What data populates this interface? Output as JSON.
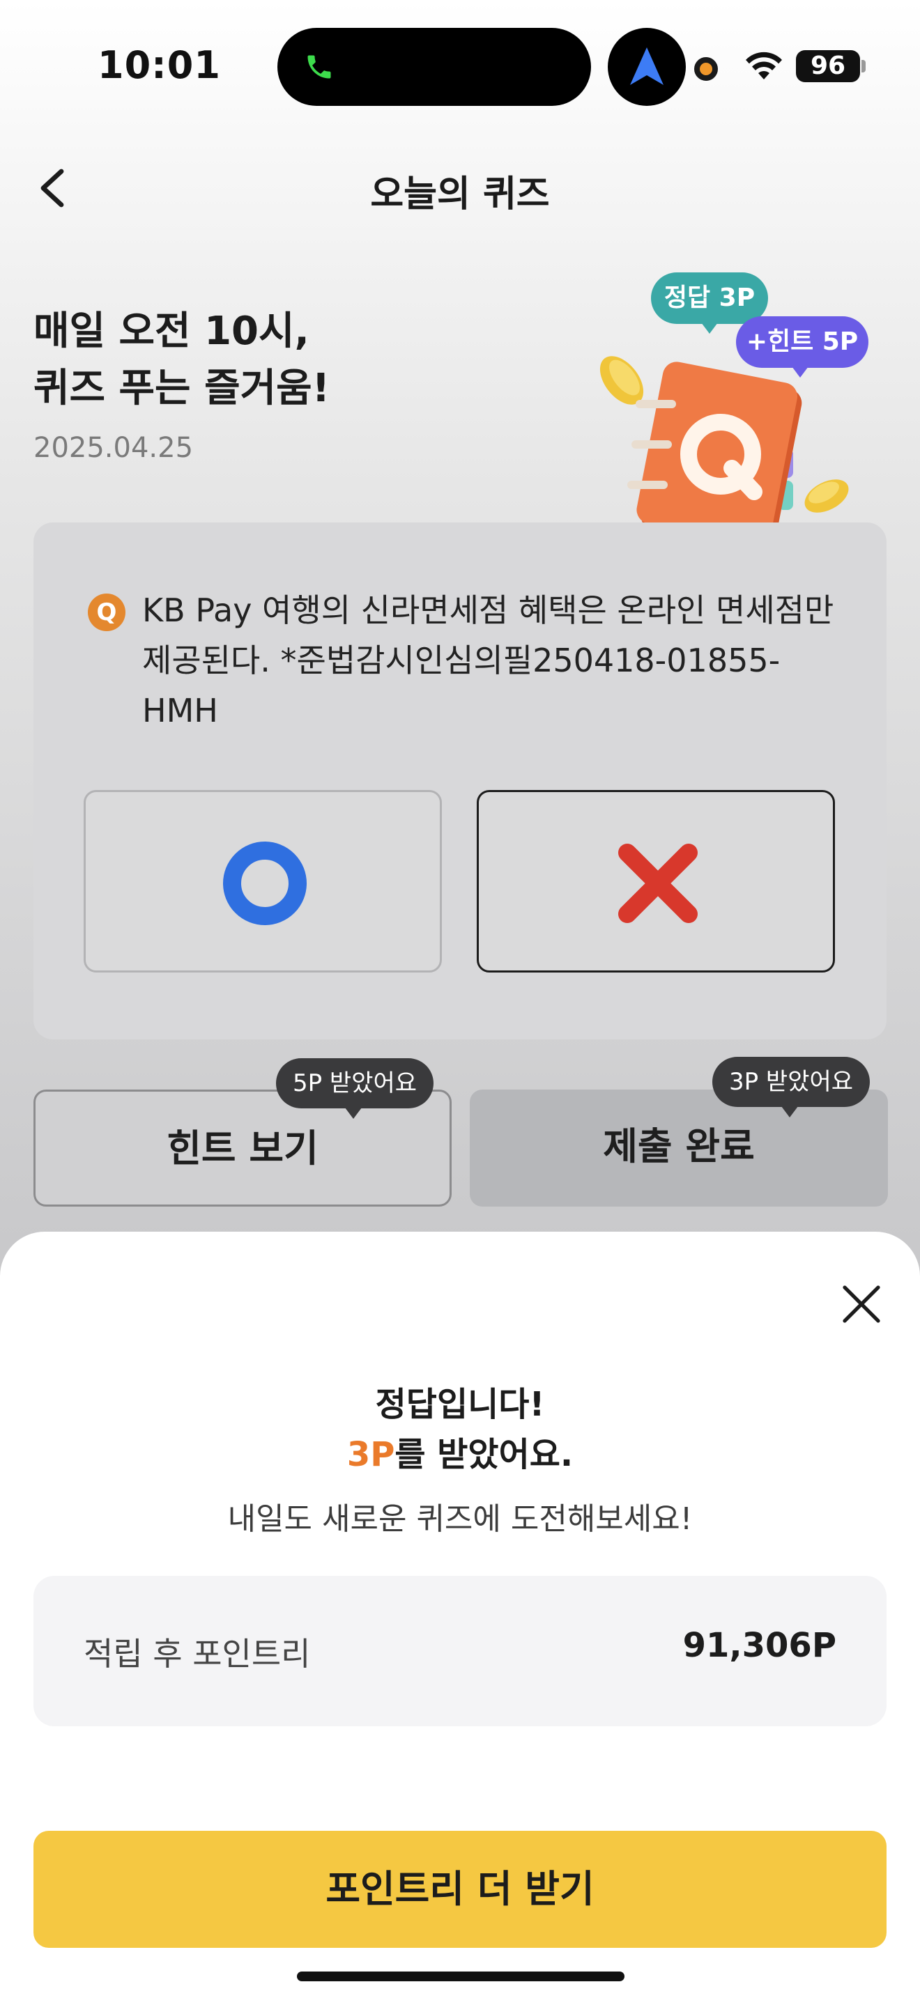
{
  "status_bar": {
    "time": "10:01",
    "battery": "96"
  },
  "header": {
    "title": "오늘의 퀴즈"
  },
  "hero": {
    "line1": "매일 오전 10시,",
    "line2": "퀴즈 푸는 즐거움!",
    "date": "2025.04.25",
    "tag_answer": "정답 3P",
    "tag_hint": "+힌트 5P",
    "illustration_letter": "Q"
  },
  "quiz": {
    "badge": "Q",
    "question": "KB Pay 여행의 신라면세점 혜택은 온라인 면세점만 제공된다. *준법감시인심의필250418-01855-HMH",
    "option_o": "O",
    "option_x": "X"
  },
  "actions": {
    "hint_label": "힌트 보기",
    "hint_bubble": "5P 받았어요",
    "submit_label": "제출 완료",
    "submit_bubble": "3P 받았어요"
  },
  "sheet": {
    "title": "정답입니다!",
    "earned_points": "3P",
    "earned_suffix": "를 받았어요.",
    "message": "내일도 새로운 퀴즈에 도전해보세요!",
    "points_label": "적립 후 포인트리",
    "points_value": "91,306P",
    "cta_label": "포인트리 더 받기"
  },
  "colors": {
    "accent_orange": "#ea7a2a",
    "cta_yellow": "#f5c842",
    "o_blue": "#2f6fe0",
    "x_red": "#d8382c",
    "tag_teal": "#3aa8a6",
    "tag_purple": "#6a5ce6"
  }
}
